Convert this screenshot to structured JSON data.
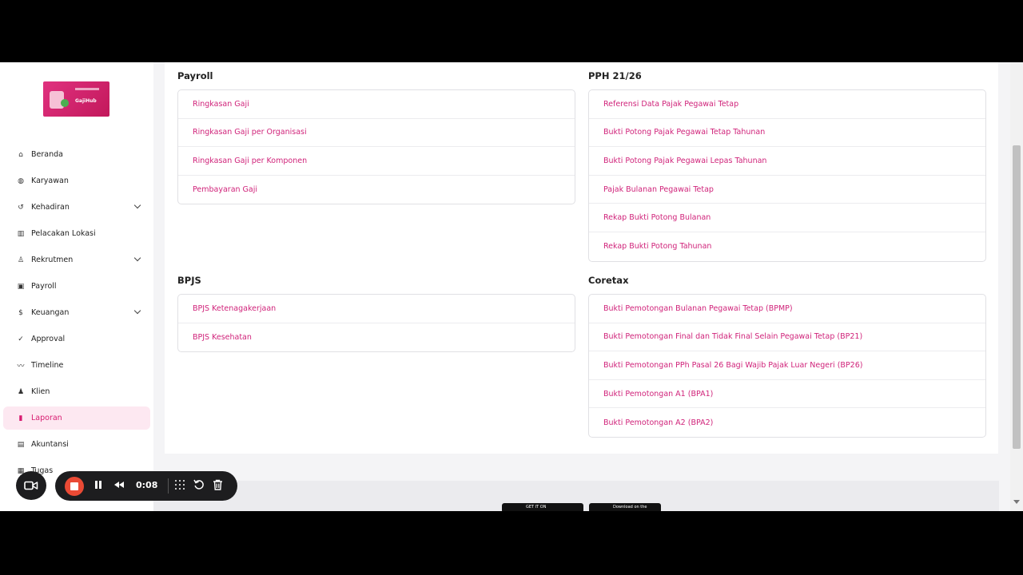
{
  "sidebar": {
    "logo": {
      "text": "GajiHub"
    },
    "items": [
      {
        "label": "Beranda",
        "icon": "home-icon",
        "glyph": "⌂",
        "has_chevron": false,
        "active": false
      },
      {
        "label": "Karyawan",
        "icon": "users-icon",
        "glyph": "◍",
        "has_chevron": false,
        "active": false
      },
      {
        "label": "Kehadiran",
        "icon": "history-icon",
        "glyph": "↺",
        "has_chevron": true,
        "active": false
      },
      {
        "label": "Pelacakan Lokasi",
        "icon": "map-icon",
        "glyph": "▥",
        "has_chevron": false,
        "active": false
      },
      {
        "label": "Rekrutmen",
        "icon": "user-plus-icon",
        "glyph": "♙",
        "has_chevron": true,
        "active": false
      },
      {
        "label": "Payroll",
        "icon": "payroll-icon",
        "glyph": "▣",
        "has_chevron": false,
        "active": false
      },
      {
        "label": "Keuangan",
        "icon": "money-icon",
        "glyph": "$",
        "has_chevron": true,
        "active": false
      },
      {
        "label": "Approval",
        "icon": "check-circle-icon",
        "glyph": "✓",
        "has_chevron": false,
        "active": false
      },
      {
        "label": "Timeline",
        "icon": "trend-icon",
        "glyph": "〰",
        "has_chevron": false,
        "active": false
      },
      {
        "label": "Klien",
        "icon": "person-icon",
        "glyph": "♟",
        "has_chevron": false,
        "active": false
      },
      {
        "label": "Laporan",
        "icon": "bar-chart-icon",
        "glyph": "▮",
        "has_chevron": false,
        "active": true
      },
      {
        "label": "Akuntansi",
        "icon": "book-icon",
        "glyph": "▤",
        "has_chevron": false,
        "active": false
      },
      {
        "label": "Tugas",
        "icon": "calendar-icon",
        "glyph": "▦",
        "has_chevron": false,
        "active": false
      }
    ]
  },
  "sections": {
    "payroll": {
      "title": "Payroll",
      "items": [
        "Ringkasan Gaji",
        "Ringkasan Gaji per Organisasi",
        "Ringkasan Gaji per Komponen",
        "Pembayaran Gaji"
      ]
    },
    "pph": {
      "title": "PPH 21/26",
      "items": [
        "Referensi Data Pajak Pegawai Tetap",
        "Bukti Potong Pajak Pegawai Tetap Tahunan",
        "Bukti Potong Pajak Pegawai Lepas Tahunan",
        "Pajak Bulanan Pegawai Tetap",
        "Rekap Bukti Potong Bulanan",
        "Rekap Bukti Potong Tahunan"
      ]
    },
    "bpjs": {
      "title": "BPJS",
      "items": [
        "BPJS Ketenagakerjaan",
        "BPJS Kesehatan"
      ]
    },
    "coretax": {
      "title": "Coretax",
      "items": [
        "Bukti Pemotongan Bulanan Pegawai Tetap (BPMP)",
        "Bukti Pemotongan Final dan Tidak Final Selain Pegawai Tetap (BP21)",
        "Bukti Pemotongan PPh Pasal 26 Bagi Wajib Pajak Luar Negeri (BP26)",
        "Bukti Pemotongan A1 (BPA1)",
        "Bukti Pemotongan A2 (BPA2)"
      ]
    }
  },
  "footer": {
    "google_play": "GET IT ON",
    "app_store": "Download on the"
  },
  "recorder": {
    "time": "0:08"
  },
  "colors": {
    "accent": "#d0237a",
    "active_bg": "#fde8f1",
    "record": "#ea4a35"
  }
}
